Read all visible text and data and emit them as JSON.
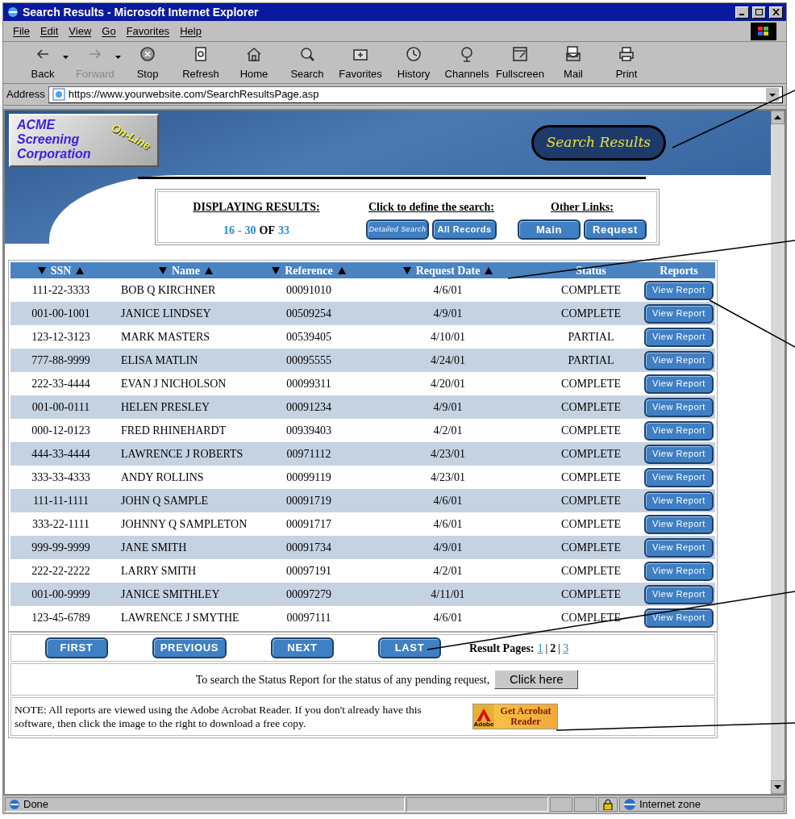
{
  "window": {
    "title": "Search Results - Microsoft Internet Explorer"
  },
  "menu": [
    "File",
    "Edit",
    "View",
    "Go",
    "Favorites",
    "Help"
  ],
  "toolbar": [
    {
      "label": "Back",
      "disabled": false
    },
    {
      "label": "Forward",
      "disabled": true
    },
    {
      "label": "Stop",
      "disabled": false
    },
    {
      "label": "Refresh",
      "disabled": false
    },
    {
      "label": "Home",
      "disabled": false
    },
    {
      "label": "Search",
      "disabled": false
    },
    {
      "label": "Favorites",
      "disabled": false
    },
    {
      "label": "History",
      "disabled": false
    },
    {
      "label": "Channels",
      "disabled": false
    },
    {
      "label": "Fullscreen",
      "disabled": false
    },
    {
      "label": "Mail",
      "disabled": false
    },
    {
      "label": "Print",
      "disabled": false
    }
  ],
  "address": {
    "label": "Address",
    "url": "https://www.yourwebsite.com/SearchResultsPage.asp"
  },
  "banner": {
    "logo_lines": [
      "ACME",
      "Screening",
      "Corporation"
    ],
    "logo_tag": "On-Line",
    "badge": "Search Results"
  },
  "info": {
    "displaying_heading": "DISPLAYING RESULTS:",
    "range_from": "16",
    "range_sep": "-",
    "range_to": "30",
    "range_of": "OF",
    "range_total": "33",
    "define_heading": "Click to define the search:",
    "define_buttons": [
      {
        "label": "Detailed Search",
        "kind": "small"
      },
      {
        "label": "All Records",
        "kind": "normal"
      }
    ],
    "links_heading": "Other Links:",
    "links": [
      "Main",
      "Request"
    ]
  },
  "table": {
    "columns": [
      {
        "label": "SSN",
        "sortable": true
      },
      {
        "label": "Name",
        "sortable": true
      },
      {
        "label": "Reference",
        "sortable": true
      },
      {
        "label": "Request Date",
        "sortable": true
      },
      {
        "label": "Status",
        "sortable": false
      },
      {
        "label": "Reports",
        "sortable": false
      }
    ],
    "rows": [
      {
        "ssn": "111-22-3333",
        "name": "BOB Q KIRCHNER",
        "reference": "00091010",
        "date": "4/6/01",
        "status": "COMPLETE",
        "report": "View Report"
      },
      {
        "ssn": "001-00-1001",
        "name": "JANICE LINDSEY",
        "reference": "00509254",
        "date": "4/9/01",
        "status": "COMPLETE",
        "report": "View Report"
      },
      {
        "ssn": "123-12-3123",
        "name": "MARK MASTERS",
        "reference": "00539405",
        "date": "4/10/01",
        "status": "PARTIAL",
        "report": "View Report"
      },
      {
        "ssn": "777-88-9999",
        "name": "ELISA MATLIN",
        "reference": "00095555",
        "date": "4/24/01",
        "status": "PARTIAL",
        "report": "View Report"
      },
      {
        "ssn": "222-33-4444",
        "name": "EVAN J NICHOLSON",
        "reference": "00099311",
        "date": "4/20/01",
        "status": "COMPLETE",
        "report": "View Report"
      },
      {
        "ssn": "001-00-0111",
        "name": "HELEN PRESLEY",
        "reference": "00091234",
        "date": "4/9/01",
        "status": "COMPLETE",
        "report": "View Report"
      },
      {
        "ssn": "000-12-0123",
        "name": "FRED RHINEHARDT",
        "reference": "00939403",
        "date": "4/2/01",
        "status": "COMPLETE",
        "report": "View Report"
      },
      {
        "ssn": "444-33-4444",
        "name": "LAWRENCE J ROBERTS",
        "reference": "00971112",
        "date": "4/23/01",
        "status": "COMPLETE",
        "report": "View Report"
      },
      {
        "ssn": "333-33-4333",
        "name": "ANDY ROLLINS",
        "reference": "00099119",
        "date": "4/23/01",
        "status": "COMPLETE",
        "report": "View Report"
      },
      {
        "ssn": "111-11-1111",
        "name": "JOHN Q SAMPLE",
        "reference": "00091719",
        "date": "4/6/01",
        "status": "COMPLETE",
        "report": "View Report"
      },
      {
        "ssn": "333-22-1111",
        "name": "JOHNNY Q SAMPLETON",
        "reference": "00091717",
        "date": "4/6/01",
        "status": "COMPLETE",
        "report": "View Report"
      },
      {
        "ssn": "999-99-9999",
        "name": "JANE SMITH",
        "reference": "00091734",
        "date": "4/9/01",
        "status": "COMPLETE",
        "report": "View Report"
      },
      {
        "ssn": "222-22-2222",
        "name": "LARRY SMITH",
        "reference": "00097191",
        "date": "4/2/01",
        "status": "COMPLETE",
        "report": "View Report"
      },
      {
        "ssn": "001-00-9999",
        "name": "JANICE SMITHLEY",
        "reference": "00097279",
        "date": "4/11/01",
        "status": "COMPLETE",
        "report": "View Report"
      },
      {
        "ssn": "123-45-6789",
        "name": "LAWRENCE J SMYTHE",
        "reference": "00097111",
        "date": "4/6/01",
        "status": "COMPLETE",
        "report": "View Report"
      }
    ]
  },
  "pagination": {
    "buttons": [
      "FIRST",
      "PREVIOUS",
      "NEXT",
      "LAST"
    ],
    "pages_label": "Result Pages:",
    "separator": "|",
    "pages": [
      {
        "label": "1",
        "selected": false
      },
      {
        "label": "2",
        "selected": true
      },
      {
        "label": "3",
        "selected": false
      }
    ]
  },
  "status_search": {
    "text": "To search the Status Report for the status of any pending request,",
    "button": "Click here"
  },
  "note": {
    "text": "NOTE: All reports are viewed using the Adobe Acrobat Reader.  If you don't already have this software, then click the image to the right to download a free copy.",
    "badge_line1": "Get Acrobat",
    "badge_line2": "Reader",
    "badge_brand": "Adobe"
  },
  "status_bar": {
    "text": "Done",
    "zone": "Internet zone"
  }
}
